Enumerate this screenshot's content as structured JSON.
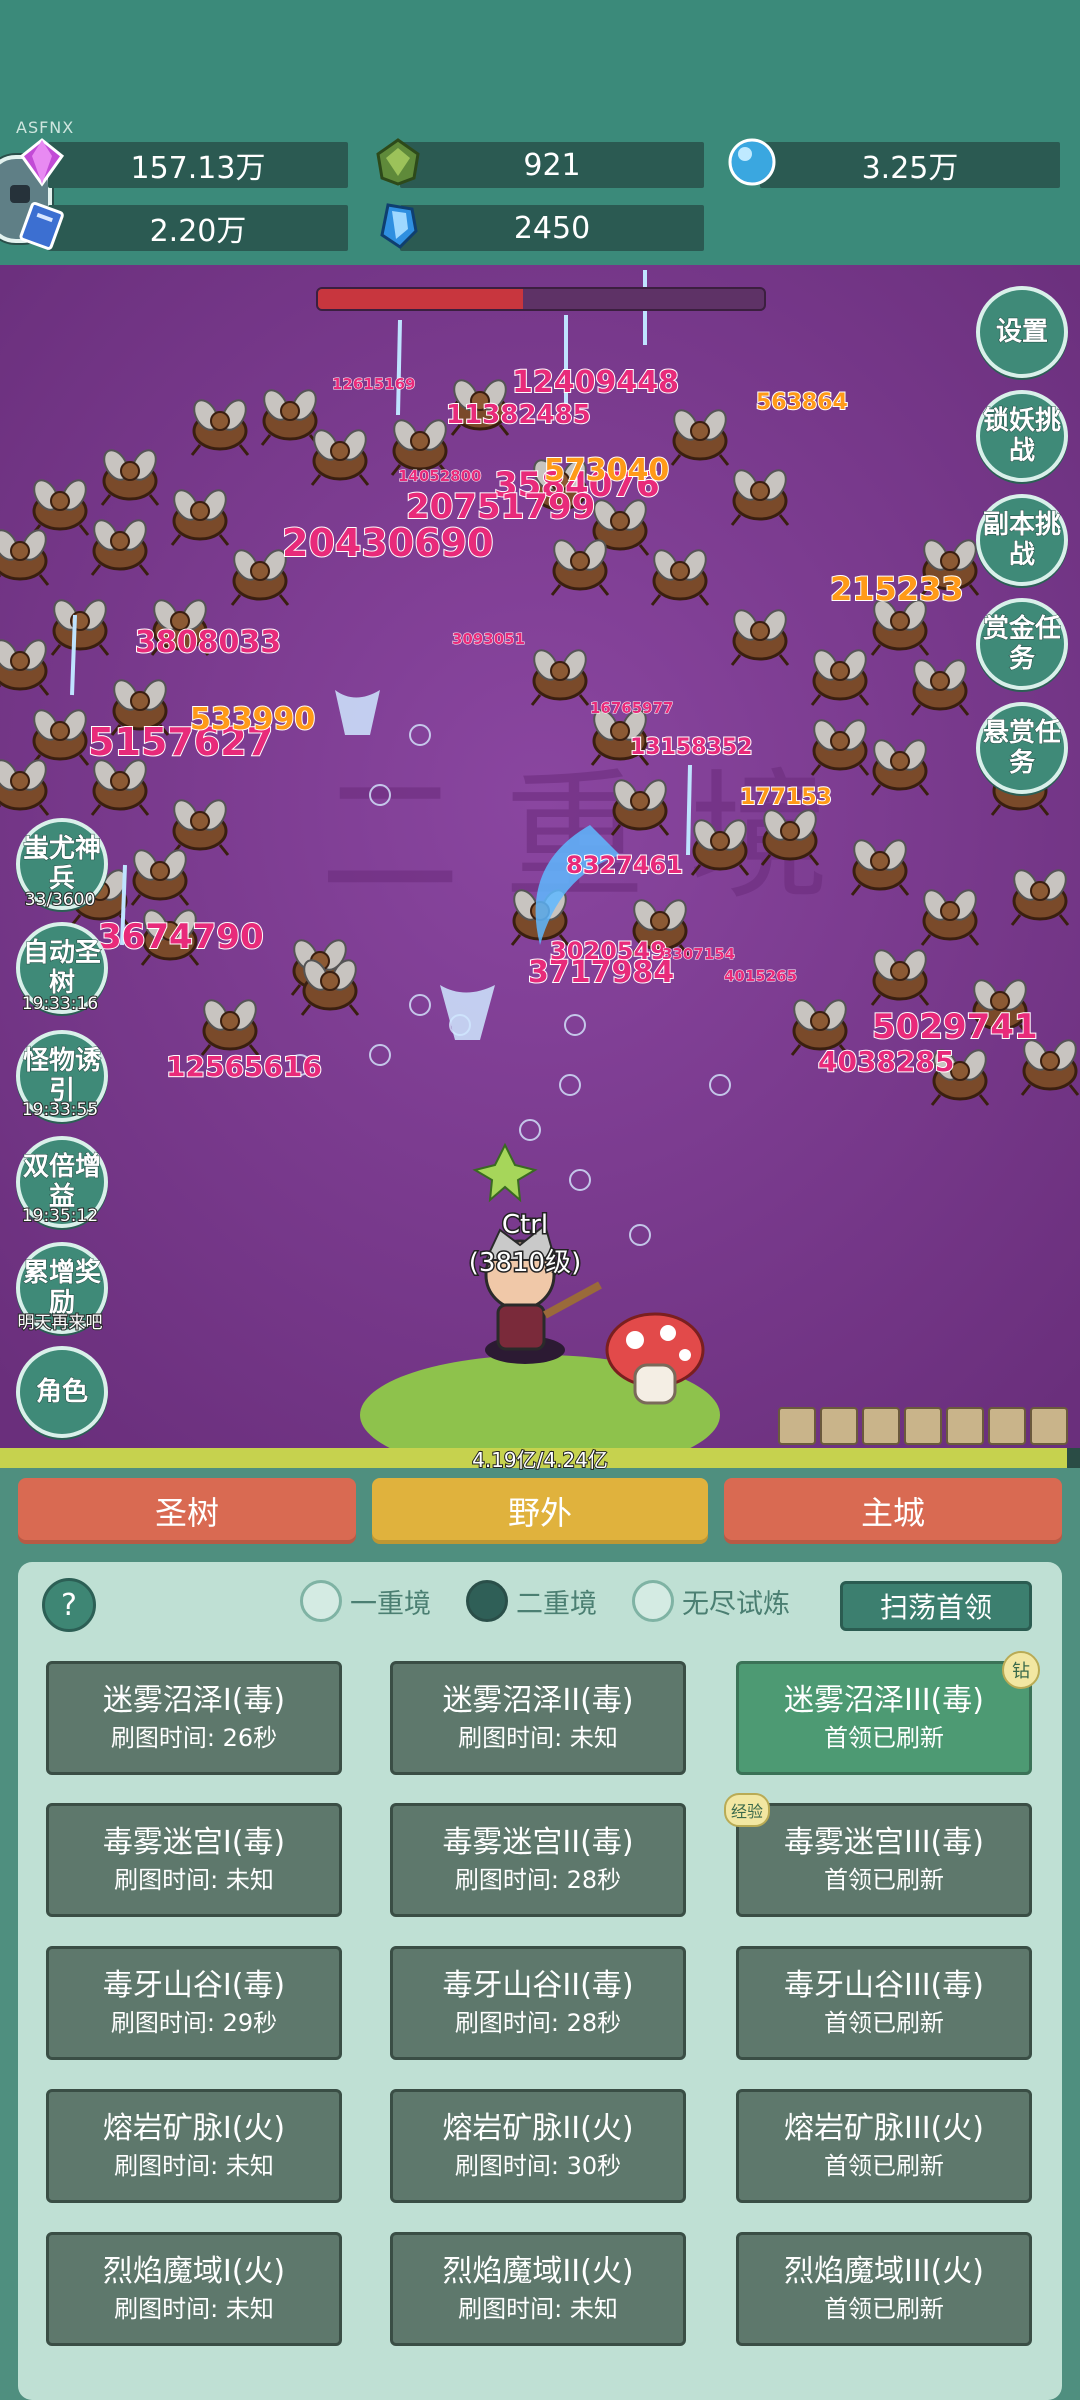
{
  "top": {
    "tag": "ASFNX",
    "resources": [
      {
        "icon": "purple-gem-icon",
        "value": "157.13万"
      },
      {
        "icon": "green-crystal-icon",
        "value": "921"
      },
      {
        "icon": "blue-orb-icon",
        "value": "3.25万"
      },
      {
        "icon": "blue-book-icon",
        "value": "2.20万"
      },
      {
        "icon": "blue-shard-icon",
        "value": "2450"
      }
    ]
  },
  "battle": {
    "boss_hp_fraction": 0.46,
    "player_name": "Ctrl",
    "player_level": "(3810级)",
    "exp_text": "4.19亿/4.24亿",
    "exp_fraction": 0.988,
    "damage_numbers": [
      {
        "text": "12409448",
        "color": "pink"
      },
      {
        "text": "11382485",
        "color": "pink"
      },
      {
        "text": "3584076",
        "color": "pink"
      },
      {
        "text": "20751799",
        "color": "pink"
      },
      {
        "text": "20430690",
        "color": "pink"
      },
      {
        "text": "3808033",
        "color": "pink"
      },
      {
        "text": "5157627",
        "color": "pink"
      },
      {
        "text": "3674790",
        "color": "pink"
      },
      {
        "text": "12565616",
        "color": "pink"
      },
      {
        "text": "3717984",
        "color": "pink"
      },
      {
        "text": "3020549",
        "color": "pink"
      },
      {
        "text": "5029741",
        "color": "pink"
      },
      {
        "text": "4038285",
        "color": "pink"
      },
      {
        "text": "8327461",
        "color": "pink"
      },
      {
        "text": "13158352",
        "color": "pink"
      },
      {
        "text": "563864",
        "color": "gold"
      },
      {
        "text": "573040",
        "color": "gold"
      },
      {
        "text": "215233",
        "color": "gold"
      },
      {
        "text": "533990",
        "color": "gold"
      },
      {
        "text": "177153",
        "color": "gold"
      },
      {
        "text": "12615169",
        "color": "pink"
      },
      {
        "text": "14052800",
        "color": "pink"
      },
      {
        "text": "3093051",
        "color": "pink"
      },
      {
        "text": "16765977",
        "color": "pink"
      },
      {
        "text": "3307154",
        "color": "pink"
      },
      {
        "text": "4015265",
        "color": "pink"
      }
    ],
    "right_buttons": [
      "设置",
      "锁妖挑战",
      "副本挑战",
      "赏金任务",
      "悬赏任务"
    ],
    "left_buttons": [
      {
        "label": "蚩尤神兵",
        "sub": "33/3600"
      },
      {
        "label": "自动圣树",
        "sub": "19:33:16"
      },
      {
        "label": "怪物诱引",
        "sub": "19:33:55"
      },
      {
        "label": "双倍增益",
        "sub": "19:35:12"
      },
      {
        "label": "累增奖励",
        "sub": "明天再来吧"
      },
      {
        "label": "角色",
        "sub": ""
      }
    ]
  },
  "tabs": [
    {
      "label": "圣树",
      "color": "#d96a52"
    },
    {
      "label": "野外",
      "color": "#e0b23d"
    },
    {
      "label": "主城",
      "color": "#d96a52"
    }
  ],
  "panel": {
    "help_label": "?",
    "radios": [
      {
        "label": "一重境",
        "selected": false
      },
      {
        "label": "二重境",
        "selected": true
      },
      {
        "label": "无尽试炼",
        "selected": false
      }
    ],
    "sweep_label": "扫荡首领",
    "maps": [
      {
        "name": "迷雾沼泽I(毒)",
        "time": "刷图时间: 26秒",
        "highlight": false,
        "badge": ""
      },
      {
        "name": "迷雾沼泽II(毒)",
        "time": "刷图时间: 未知",
        "highlight": false,
        "badge": ""
      },
      {
        "name": "迷雾沼泽III(毒)",
        "time": "首领已刷新",
        "highlight": true,
        "badge": "钻"
      },
      {
        "name": "毒雾迷宫I(毒)",
        "time": "刷图时间: 未知",
        "highlight": false,
        "badge": ""
      },
      {
        "name": "毒雾迷宫II(毒)",
        "time": "刷图时间: 28秒",
        "highlight": false,
        "badge": ""
      },
      {
        "name": "毒雾迷宫III(毒)",
        "time": "首领已刷新",
        "highlight": false,
        "badge": "经验"
      },
      {
        "name": "毒牙山谷I(毒)",
        "time": "刷图时间: 29秒",
        "highlight": false,
        "badge": ""
      },
      {
        "name": "毒牙山谷II(毒)",
        "time": "刷图时间: 28秒",
        "highlight": false,
        "badge": ""
      },
      {
        "name": "毒牙山谷III(毒)",
        "time": "首领已刷新",
        "highlight": false,
        "badge": ""
      },
      {
        "name": "熔岩矿脉I(火)",
        "time": "刷图时间: 未知",
        "highlight": false,
        "badge": ""
      },
      {
        "name": "熔岩矿脉II(火)",
        "time": "刷图时间: 30秒",
        "highlight": false,
        "badge": ""
      },
      {
        "name": "熔岩矿脉III(火)",
        "time": "首领已刷新",
        "highlight": false,
        "badge": ""
      },
      {
        "name": "烈焰魔域I(火)",
        "time": "刷图时间: 未知",
        "highlight": false,
        "badge": ""
      },
      {
        "name": "烈焰魔域II(火)",
        "time": "刷图时间: 未知",
        "highlight": false,
        "badge": ""
      },
      {
        "name": "烈焰魔域III(火)",
        "time": "首领已刷新",
        "highlight": false,
        "badge": ""
      }
    ]
  }
}
